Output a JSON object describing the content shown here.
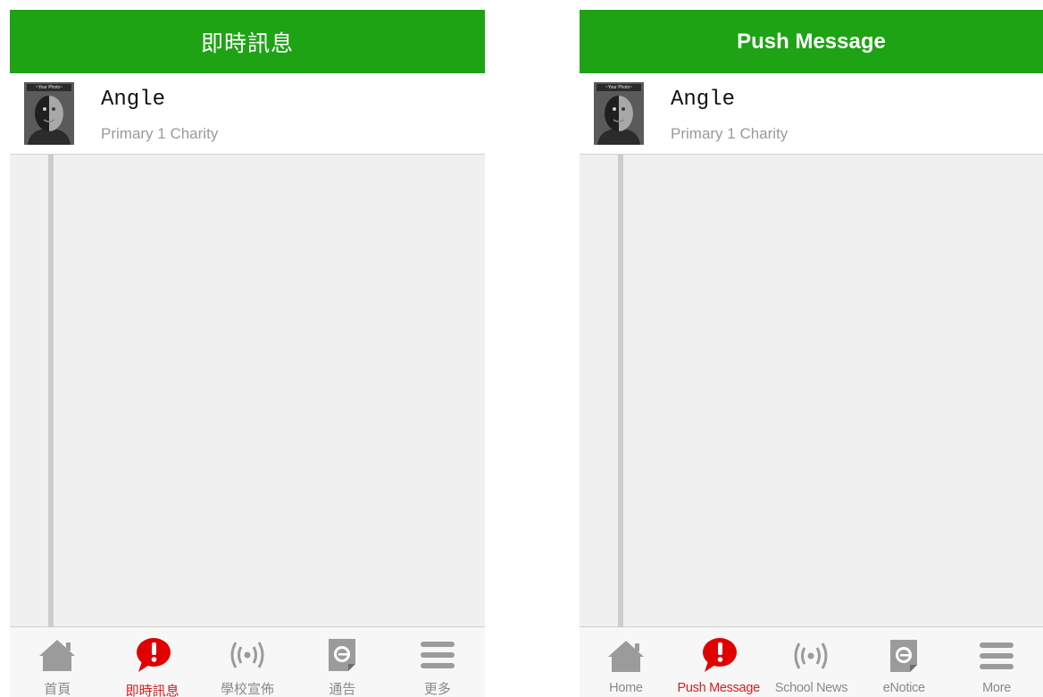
{
  "screens": {
    "left": {
      "header": {
        "title": "即時訊息"
      },
      "profile": {
        "name": "Angle",
        "subtitle": "Primary 1 Charity",
        "avatar_caption": "~Your Photo~"
      },
      "tabs": [
        {
          "label": "首頁",
          "icon": "home-icon"
        },
        {
          "label": "即時訊息",
          "icon": "message-alert-icon",
          "active": true
        },
        {
          "label": "學校宣佈",
          "icon": "broadcast-icon"
        },
        {
          "label": "通告",
          "icon": "notice-icon"
        },
        {
          "label": "更多",
          "icon": "menu-icon"
        }
      ]
    },
    "right": {
      "header": {
        "title": "Push Message"
      },
      "profile": {
        "name": "Angle",
        "subtitle": "Primary 1 Charity",
        "avatar_caption": "~Your Photo~"
      },
      "tabs": [
        {
          "label": "Home",
          "icon": "home-icon"
        },
        {
          "label": "Push Message",
          "icon": "message-alert-icon",
          "active": true
        },
        {
          "label": "School News",
          "icon": "broadcast-icon"
        },
        {
          "label": "eNotice",
          "icon": "notice-icon"
        },
        {
          "label": "More",
          "icon": "menu-icon"
        }
      ]
    }
  },
  "colors": {
    "header": "#1da314",
    "active_tab": "#d51f1f",
    "inactive_tab": "#8a8a8a",
    "content_bg": "#f0f0f0",
    "timeline": "#cccccc"
  }
}
